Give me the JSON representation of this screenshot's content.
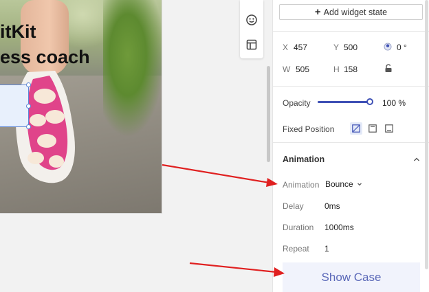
{
  "canvas": {
    "headline_line1": "itKit",
    "headline_line2": "ess coach"
  },
  "panel": {
    "add_widget_state_label": "Add widget state",
    "position": {
      "x_label": "X",
      "x_value": "457",
      "y_label": "Y",
      "y_value": "500",
      "rotation_value": "0 °",
      "w_label": "W",
      "w_value": "505",
      "h_label": "H",
      "h_value": "158"
    },
    "opacity": {
      "label": "Opacity",
      "value": "100 %",
      "level": 1.0
    },
    "fixed_position": {
      "label": "Fixed Position"
    },
    "animation": {
      "section_title": "Animation",
      "animation_label": "Animation",
      "animation_value": "Bounce",
      "delay_label": "Delay",
      "delay_value": "0ms",
      "duration_label": "Duration",
      "duration_value": "1000ms",
      "repeat_label": "Repeat",
      "repeat_value": "1"
    },
    "show_case_label": "Show Case"
  },
  "colors": {
    "accent": "#3f51b5",
    "annotation_arrow": "#e02020",
    "selection": "#5d86d6"
  }
}
